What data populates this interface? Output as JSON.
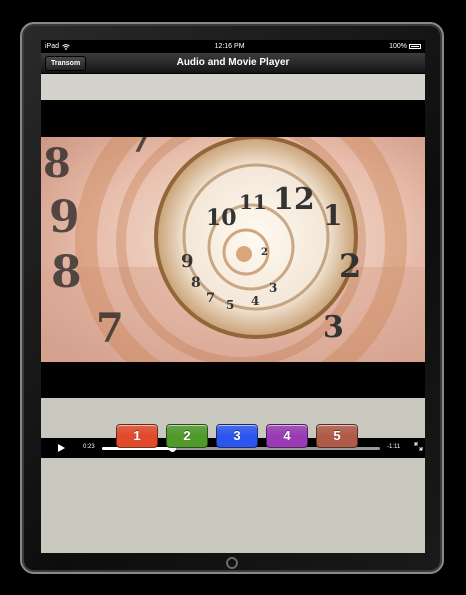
{
  "status_bar": {
    "carrier": "iPad",
    "time": "12:16 PM",
    "battery": "100%"
  },
  "nav_bar": {
    "back_label": "Transom",
    "title": "Audio and Movie Player"
  },
  "player": {
    "elapsed": "0:23",
    "remaining": "-1:11",
    "progress": 0.25
  },
  "buttons": [
    {
      "label": "1",
      "color": "#e14a2a"
    },
    {
      "label": "2",
      "color": "#4f9a2a"
    },
    {
      "label": "3",
      "color": "#2a55ef"
    },
    {
      "label": "4",
      "color": "#9a3ab5"
    },
    {
      "label": "5",
      "color": "#b05a48"
    }
  ],
  "icons": {
    "wifi": "wifi-icon",
    "battery": "battery-icon",
    "play": "play-icon",
    "fullscreen": "fullscreen-icon",
    "home": "home-button"
  }
}
